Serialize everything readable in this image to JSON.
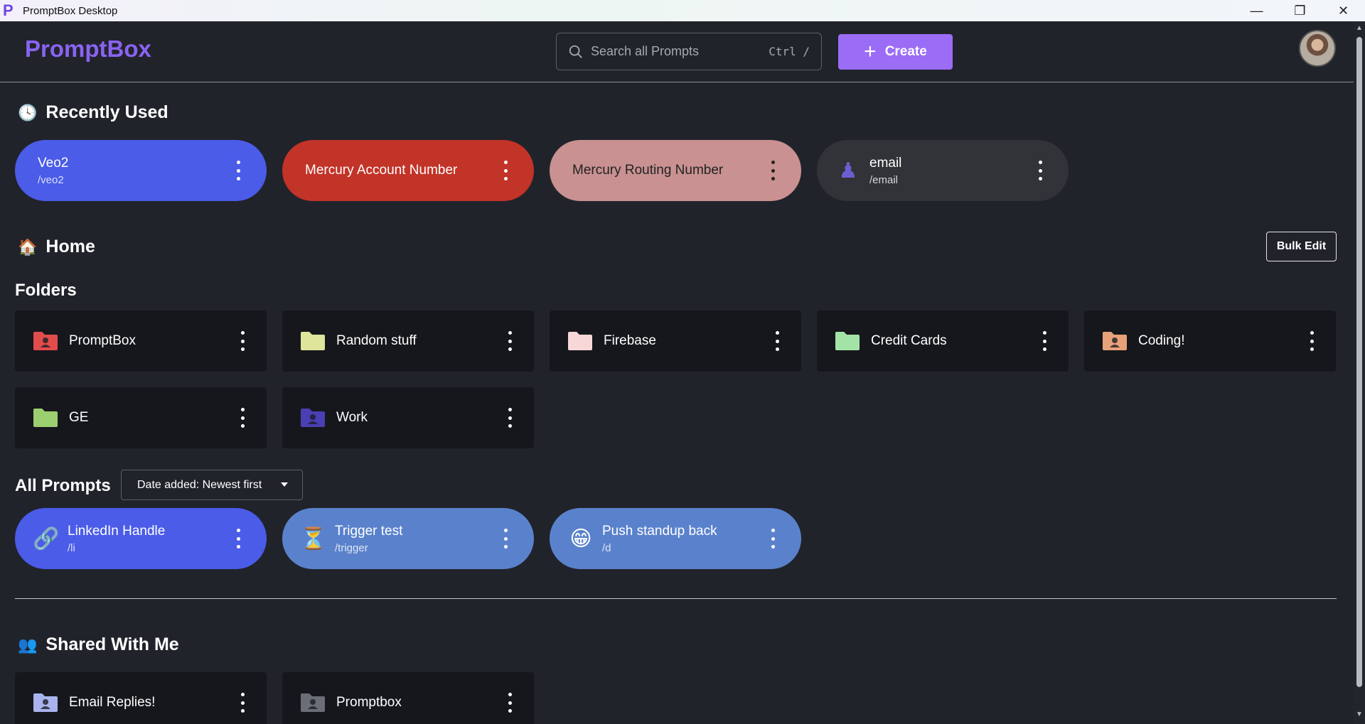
{
  "window": {
    "title": "PromptBox Desktop",
    "icon_glyph": "P",
    "controls": [
      "minimize",
      "restore",
      "close"
    ]
  },
  "header": {
    "logo": "PromptBox",
    "search_placeholder": "Search all Prompts",
    "search_shortcut": "Ctrl /",
    "create_label": "Create"
  },
  "recently_used": {
    "title": "Recently Used",
    "icon": "clock-icon",
    "items": [
      {
        "name": "Veo2",
        "shortcut": "/veo2",
        "color": "#4a5ce8",
        "icon": ""
      },
      {
        "name": "Mercury Account Number",
        "shortcut": "",
        "color": "#c23328",
        "icon": ""
      },
      {
        "name": "Mercury Routing Number",
        "shortcut": "",
        "color": "#c99191",
        "icon": ""
      },
      {
        "name": "email",
        "shortcut": "/email",
        "color": "#323338",
        "icon": "chess-pawn-icon"
      }
    ]
  },
  "home": {
    "title": "Home",
    "icon": "house-icon",
    "bulk_edit_label": "Bulk Edit",
    "folders_title": "Folders",
    "folders": [
      {
        "name": "PromptBox",
        "color": "#e24c4c",
        "icon": "folder-shared-icon"
      },
      {
        "name": "Random stuff",
        "color": "#dfe59b",
        "icon": "folder-icon"
      },
      {
        "name": "Firebase",
        "color": "#f7d7d7",
        "icon": "folder-icon"
      },
      {
        "name": "Credit Cards",
        "color": "#a4e3a8",
        "icon": "folder-icon"
      },
      {
        "name": "Coding!",
        "color": "#e8a27a",
        "icon": "folder-shared-icon"
      },
      {
        "name": "GE",
        "color": "#9ccf6f",
        "icon": "folder-icon"
      },
      {
        "name": "Work",
        "color": "#4a3fb3",
        "icon": "folder-shared-icon"
      }
    ]
  },
  "all_prompts": {
    "title": "All Prompts",
    "sort_value": "Date added: Newest first",
    "items": [
      {
        "name": "LinkedIn Handle",
        "shortcut": "/li",
        "color": "#4a5ce8",
        "icon": "link-icon",
        "glyph": "🔗"
      },
      {
        "name": "Trigger test",
        "shortcut": "/trigger",
        "color": "#5a82cc",
        "icon": "hourglass-icon",
        "glyph": "⏳"
      },
      {
        "name": "Push standup back",
        "shortcut": "/d",
        "color": "#5a82cc",
        "icon": "grinning-face-icon",
        "glyph": "😁"
      }
    ]
  },
  "shared": {
    "title": "Shared With Me",
    "icon": "people-icon",
    "folders": [
      {
        "name": "Email Replies!",
        "color": "#a9b4ef",
        "icon": "folder-shared-icon"
      },
      {
        "name": "Promptbox",
        "color": "#6b6e77",
        "icon": "folder-shared-icon"
      }
    ]
  }
}
